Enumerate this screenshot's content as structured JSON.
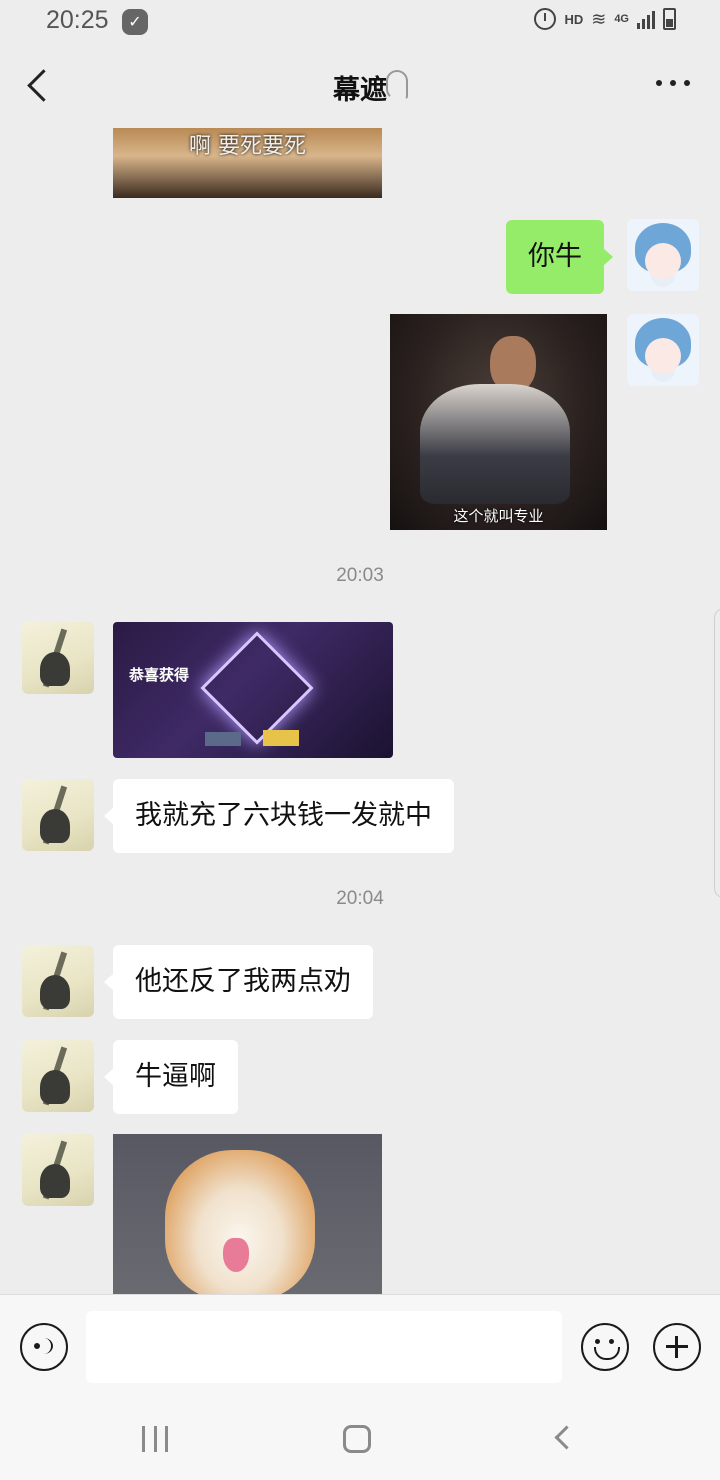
{
  "status_bar": {
    "time": "20:25",
    "hd": "HD",
    "network": "4G"
  },
  "header": {
    "title": "幕遮"
  },
  "messages": [
    {
      "from": "friend",
      "type": "image",
      "caption": "啊 要死要死"
    },
    {
      "from": "me",
      "type": "text",
      "text": "你牛"
    },
    {
      "from": "me",
      "type": "image",
      "caption": "这个就叫专业"
    },
    {
      "type": "timestamp",
      "text": "20:03"
    },
    {
      "from": "friend",
      "type": "image",
      "caption": "恭喜获得"
    },
    {
      "from": "friend",
      "type": "text",
      "text": "我就充了六块钱一发就中"
    },
    {
      "type": "timestamp",
      "text": "20:04"
    },
    {
      "from": "friend",
      "type": "text",
      "text": "他还反了我两点劝"
    },
    {
      "from": "friend",
      "type": "text",
      "text": "牛逼啊"
    },
    {
      "from": "friend",
      "type": "image",
      "caption": ""
    }
  ],
  "input_bar": {
    "placeholder": ""
  },
  "colors": {
    "chat_background": "#ededed",
    "my_bubble": "#95ec69",
    "friend_bubble": "#ffffff"
  }
}
